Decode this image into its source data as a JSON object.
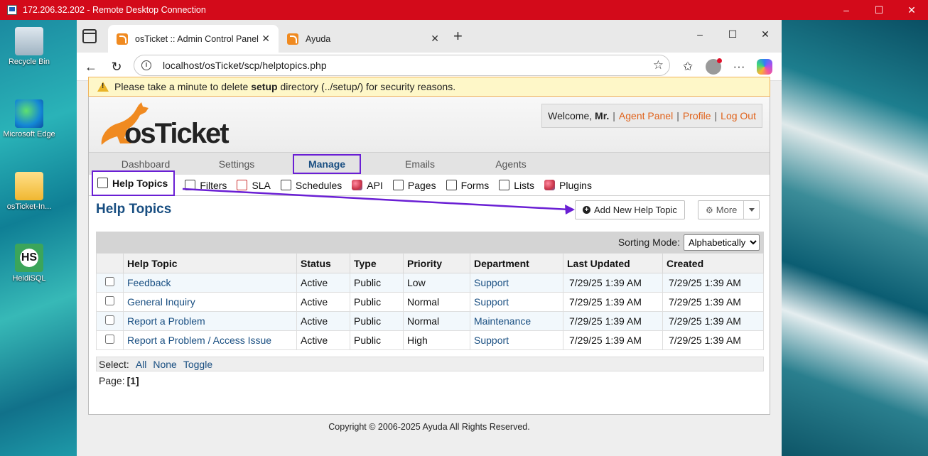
{
  "rdp": {
    "title": "172.206.32.202 - Remote Desktop Connection",
    "minimize": "–",
    "maximize": "☐",
    "close": "✕"
  },
  "desktop": {
    "icons": [
      {
        "label": "Recycle Bin"
      },
      {
        "label": "Microsoft Edge"
      },
      {
        "label": "osTicket-In..."
      },
      {
        "label": "HeidiSQL",
        "glyph": "HS"
      }
    ]
  },
  "browser": {
    "tabs": [
      {
        "label": "osTicket :: Admin Control Panel",
        "close": "✕"
      },
      {
        "label": "Ayuda",
        "close": "✕"
      }
    ],
    "new_tab": "+",
    "window_controls": {
      "minimize": "–",
      "maximize": "☐",
      "close": "✕"
    },
    "nav": {
      "back": "←",
      "reload": "↻",
      "favorites": "✩",
      "more": "···"
    },
    "address": "localhost/osTicket/scp/helptopics.php",
    "star": "☆"
  },
  "page": {
    "warning": {
      "pre": "Please take a minute to delete ",
      "bold": "setup",
      "post": " directory (../setup/) for security reasons."
    },
    "logo": {
      "text": "osTicket"
    },
    "welcome": {
      "prefix": "Welcome, ",
      "name": "Mr.",
      "links": [
        "Agent Panel",
        "Profile",
        "Log Out"
      ],
      "separator": "|"
    },
    "main_nav": [
      "Dashboard",
      "Settings",
      "Manage",
      "Emails",
      "Agents"
    ],
    "active_main_nav": "Manage",
    "sub_nav": [
      "Help Topics",
      "Filters",
      "SLA",
      "Schedules",
      "API",
      "Pages",
      "Forms",
      "Lists",
      "Plugins"
    ],
    "title": "Help Topics",
    "add_button": "Add New Help Topic",
    "more_button": "More",
    "sorting_label": "Sorting Mode:",
    "sorting_value": "Alphabetically",
    "table": {
      "headers": [
        "Help Topic",
        "Status",
        "Type",
        "Priority",
        "Department",
        "Last Updated",
        "Created"
      ],
      "rows": [
        {
          "topic": "Feedback",
          "status": "Active",
          "type": "Public",
          "priority": "Low",
          "department": "Support",
          "updated": "7/29/25 1:39 AM",
          "created": "7/29/25 1:39 AM"
        },
        {
          "topic": "General Inquiry",
          "status": "Active",
          "type": "Public",
          "priority": "Normal",
          "department": "Support",
          "updated": "7/29/25 1:39 AM",
          "created": "7/29/25 1:39 AM"
        },
        {
          "topic": "Report a Problem",
          "status": "Active",
          "type": "Public",
          "priority": "Normal",
          "department": "Maintenance",
          "updated": "7/29/25 1:39 AM",
          "created": "7/29/25 1:39 AM"
        },
        {
          "topic": "Report a Problem / Access Issue",
          "status": "Active",
          "type": "Public",
          "priority": "High",
          "department": "Support",
          "updated": "7/29/25 1:39 AM",
          "created": "7/29/25 1:39 AM"
        }
      ]
    },
    "select": {
      "label": "Select:",
      "all": "All",
      "none": "None",
      "toggle": "Toggle"
    },
    "pager": {
      "label": "Page:",
      "current": "[1]"
    },
    "copyright": "Copyright © 2006-2025 Ayuda All Rights Reserved."
  },
  "colors": {
    "rdp_bar": "#d30a1a",
    "link": "#184e81",
    "accent_orange": "#e0621b",
    "highlight_purple": "#6a1fd4"
  }
}
